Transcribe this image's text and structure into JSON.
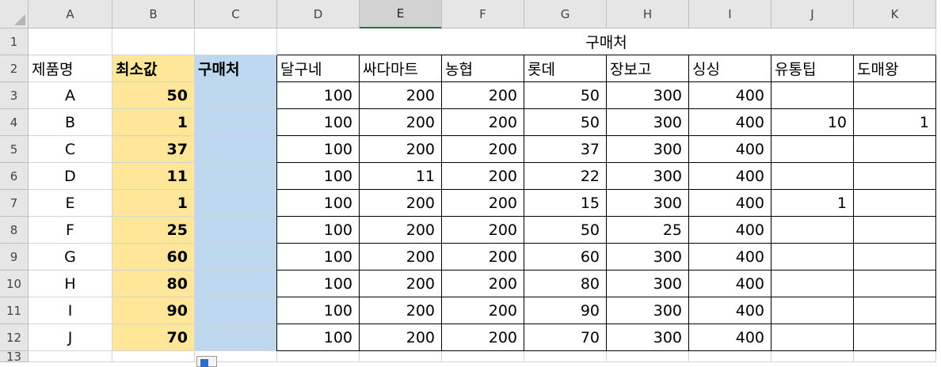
{
  "columns": [
    "A",
    "B",
    "C",
    "D",
    "E",
    "F",
    "G",
    "H",
    "I",
    "J",
    "K"
  ],
  "rows": [
    "1",
    "2",
    "3",
    "4",
    "5",
    "6",
    "7",
    "8",
    "9",
    "10",
    "11",
    "12",
    "13"
  ],
  "selected_column": "E",
  "merged_title": "구매처",
  "headers": [
    "제품명",
    "최소값",
    "구매처",
    "달구네",
    "싸다마트",
    "농협",
    "롯데",
    "장보고",
    "싱싱",
    "유통팁",
    "도매왕"
  ],
  "data_rows": [
    [
      "A",
      "50",
      "",
      "100",
      "200",
      "200",
      "50",
      "300",
      "400",
      "",
      ""
    ],
    [
      "B",
      "1",
      "",
      "100",
      "200",
      "200",
      "50",
      "300",
      "400",
      "10",
      "1"
    ],
    [
      "C",
      "37",
      "",
      "100",
      "200",
      "200",
      "37",
      "300",
      "400",
      "",
      ""
    ],
    [
      "D",
      "11",
      "",
      "100",
      "11",
      "200",
      "22",
      "300",
      "400",
      "",
      ""
    ],
    [
      "E",
      "1",
      "",
      "100",
      "200",
      "200",
      "15",
      "300",
      "400",
      "1",
      ""
    ],
    [
      "F",
      "25",
      "",
      "100",
      "200",
      "200",
      "50",
      "25",
      "400",
      "",
      ""
    ],
    [
      "G",
      "60",
      "",
      "100",
      "200",
      "200",
      "60",
      "300",
      "400",
      "",
      ""
    ],
    [
      "H",
      "80",
      "",
      "100",
      "200",
      "200",
      "80",
      "300",
      "400",
      "",
      ""
    ],
    [
      "I",
      "90",
      "",
      "100",
      "200",
      "200",
      "90",
      "300",
      "400",
      "",
      ""
    ],
    [
      "J",
      "70",
      "",
      "100",
      "200",
      "200",
      "70",
      "300",
      "400",
      "",
      ""
    ]
  ],
  "colors": {
    "min_column_fill": "#ffe699",
    "vendor_column_fill": "#bdd7ee",
    "header_bg": "#e6e6e6",
    "selected_header_bg": "#d2d2d2",
    "accent": "#217346"
  },
  "icons": {
    "paste_options": "paste-options-icon",
    "select_all": "select-all-corner-icon"
  }
}
